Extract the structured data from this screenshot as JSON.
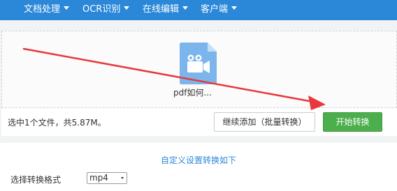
{
  "nav": {
    "items": [
      {
        "label": "文档处理",
        "icon": "caret-down-icon"
      },
      {
        "label": "OCR识别",
        "icon": "caret-down-icon"
      },
      {
        "label": "在线编辑",
        "icon": "caret-down-icon"
      },
      {
        "label": "客户端",
        "icon": "caret-down-icon"
      }
    ],
    "background": "#2b88d9"
  },
  "upload": {
    "file_icon": "video-file-icon",
    "file_name": "pdf如何...",
    "file_icon_color": "#7cb5ec"
  },
  "annotation": {
    "type": "red-arrow",
    "color": "#e8383d"
  },
  "actions": {
    "status": "选中1个文件，共5.87M。",
    "continue_label": "继续添加（批量转换）",
    "start_label": "开始转换",
    "start_color": "#4cae4c"
  },
  "settings": {
    "link_label": "自定义设置转换如下",
    "format_label": "选择转换格式",
    "format_value": "mp4"
  }
}
